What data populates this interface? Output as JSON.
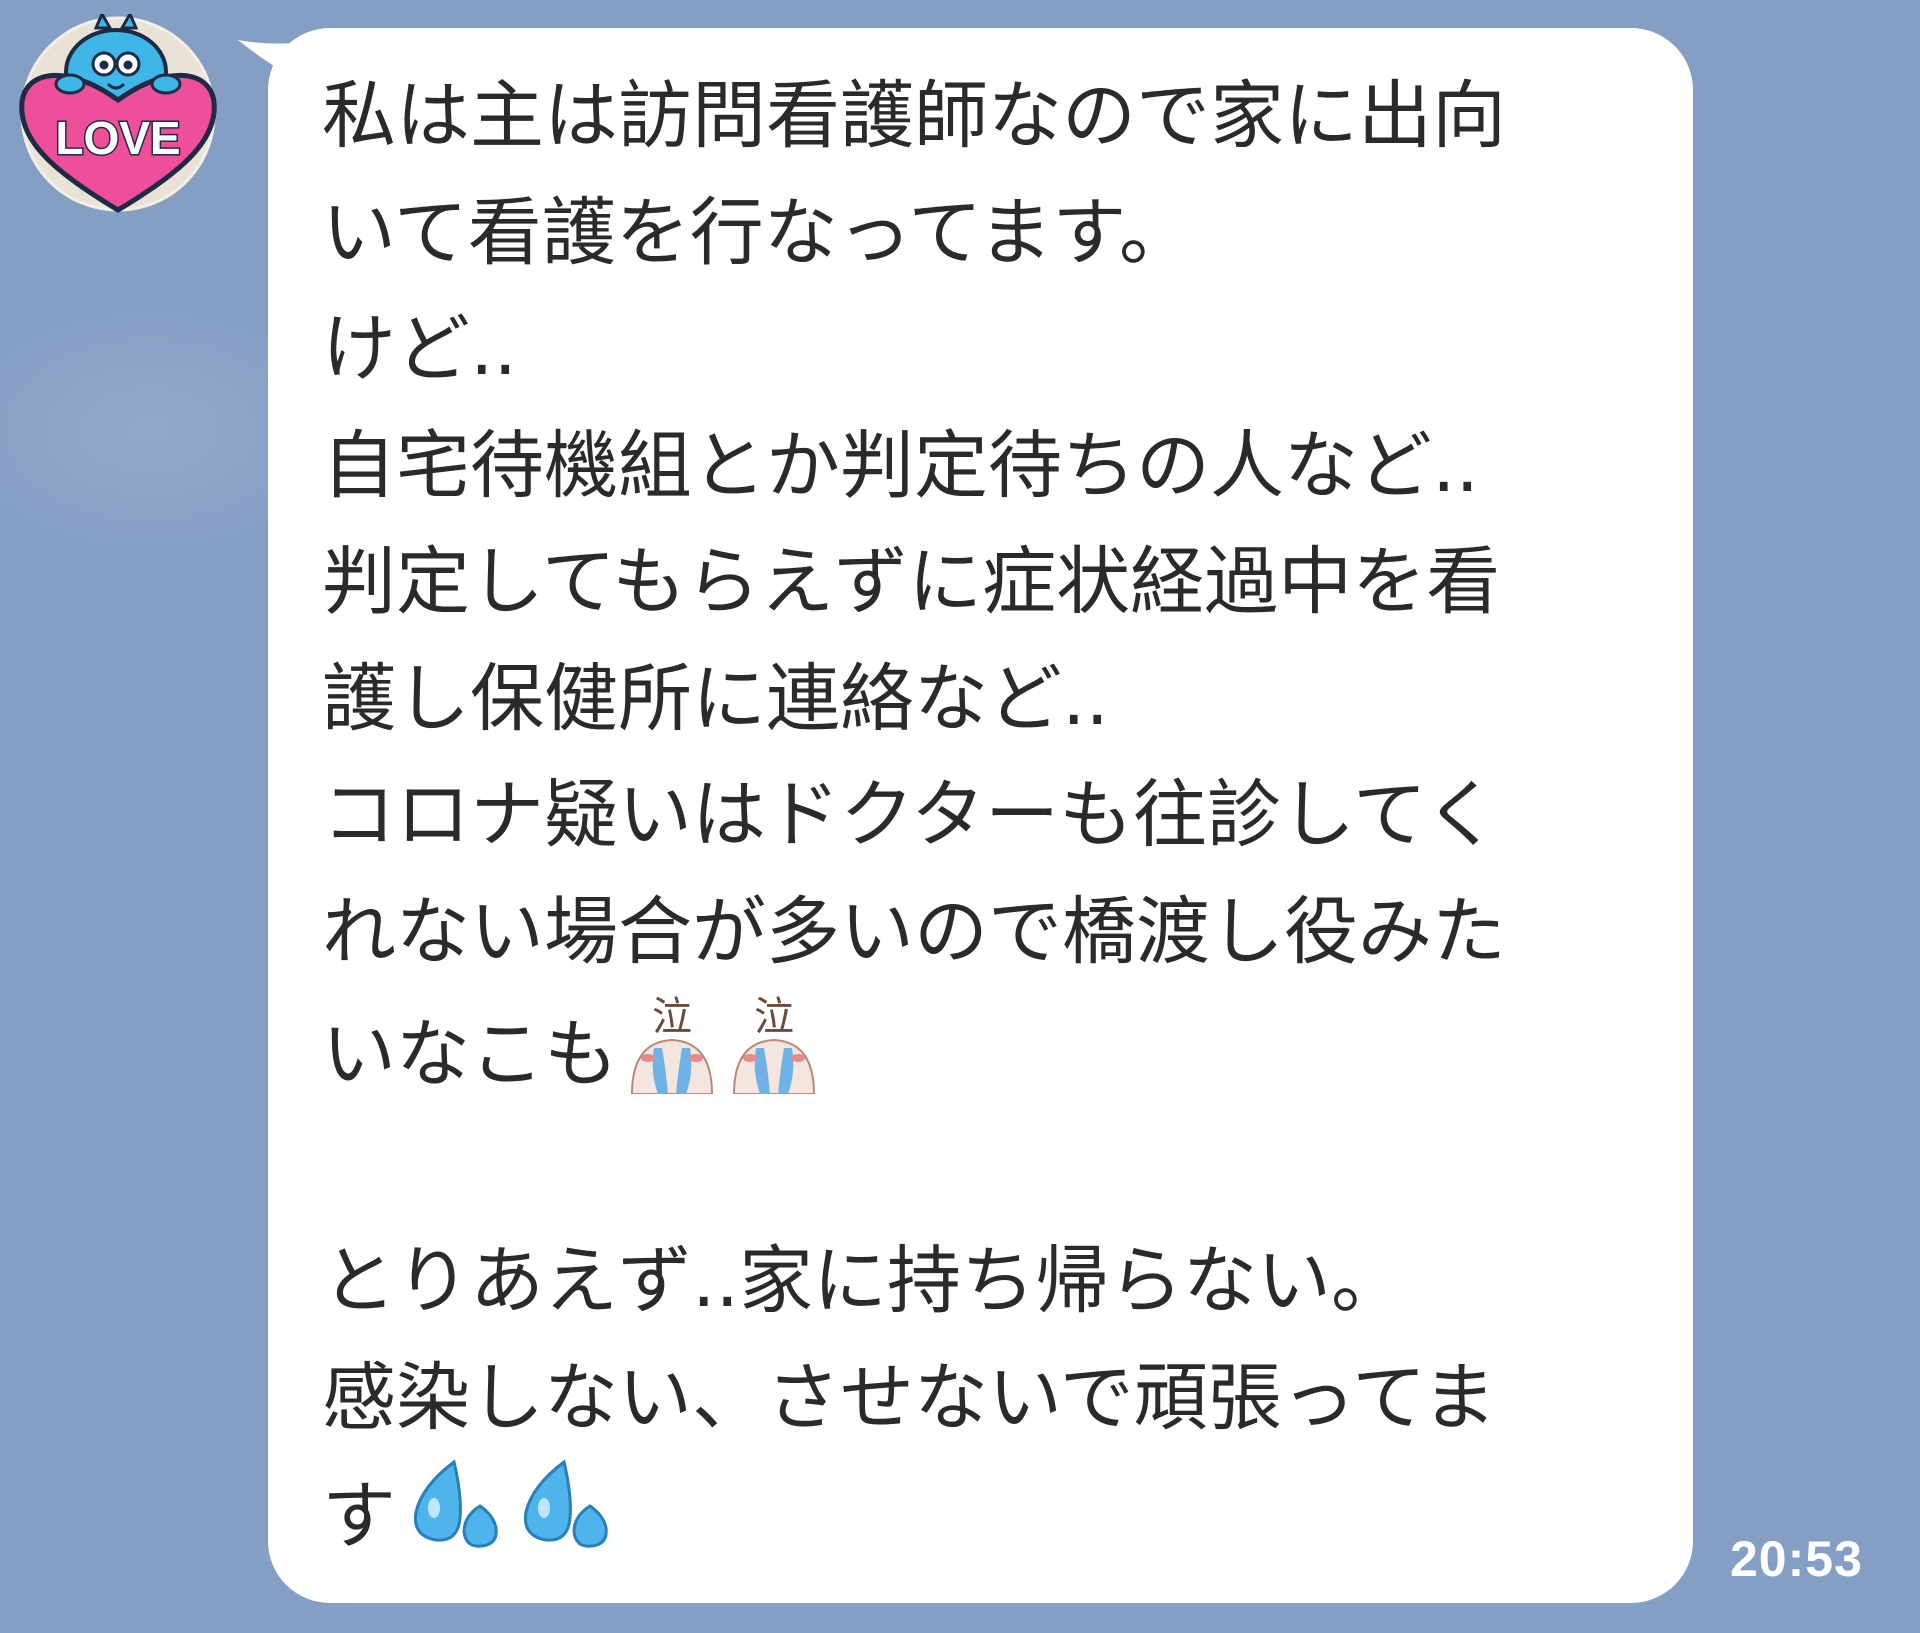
{
  "chat": {
    "background_color": "#859ec4",
    "bubble_color": "#ffffff",
    "text_color": "#2a2a2a"
  },
  "avatar": {
    "icon": "love-heart-sticker-icon",
    "text": "LOVE",
    "colors": {
      "heart": "#ee4f9a",
      "character": "#3fb6e8"
    }
  },
  "message": {
    "lines": [
      "私は主は訪問看護師なので家に出向",
      "いて看護を行なってます。",
      "けど..",
      "自宅待機組とか判定待ちの人など..",
      "判定してもらえずに症状経過中を看",
      "護し保健所に連絡など..",
      "コロナ疑いはドクターも往診してく",
      "れない場合が多いので橋渡し役みた",
      "いなこも",
      "",
      "とりあえず..家に持ち帰らない。",
      "感染しない、させないで頑張ってま",
      "す"
    ],
    "crying_emoji_text": "泣",
    "crying_emoji_icon": "crying-face-icon",
    "sweat_emoji_icon": "sweat-drops-icon",
    "timestamp": "20:53"
  }
}
